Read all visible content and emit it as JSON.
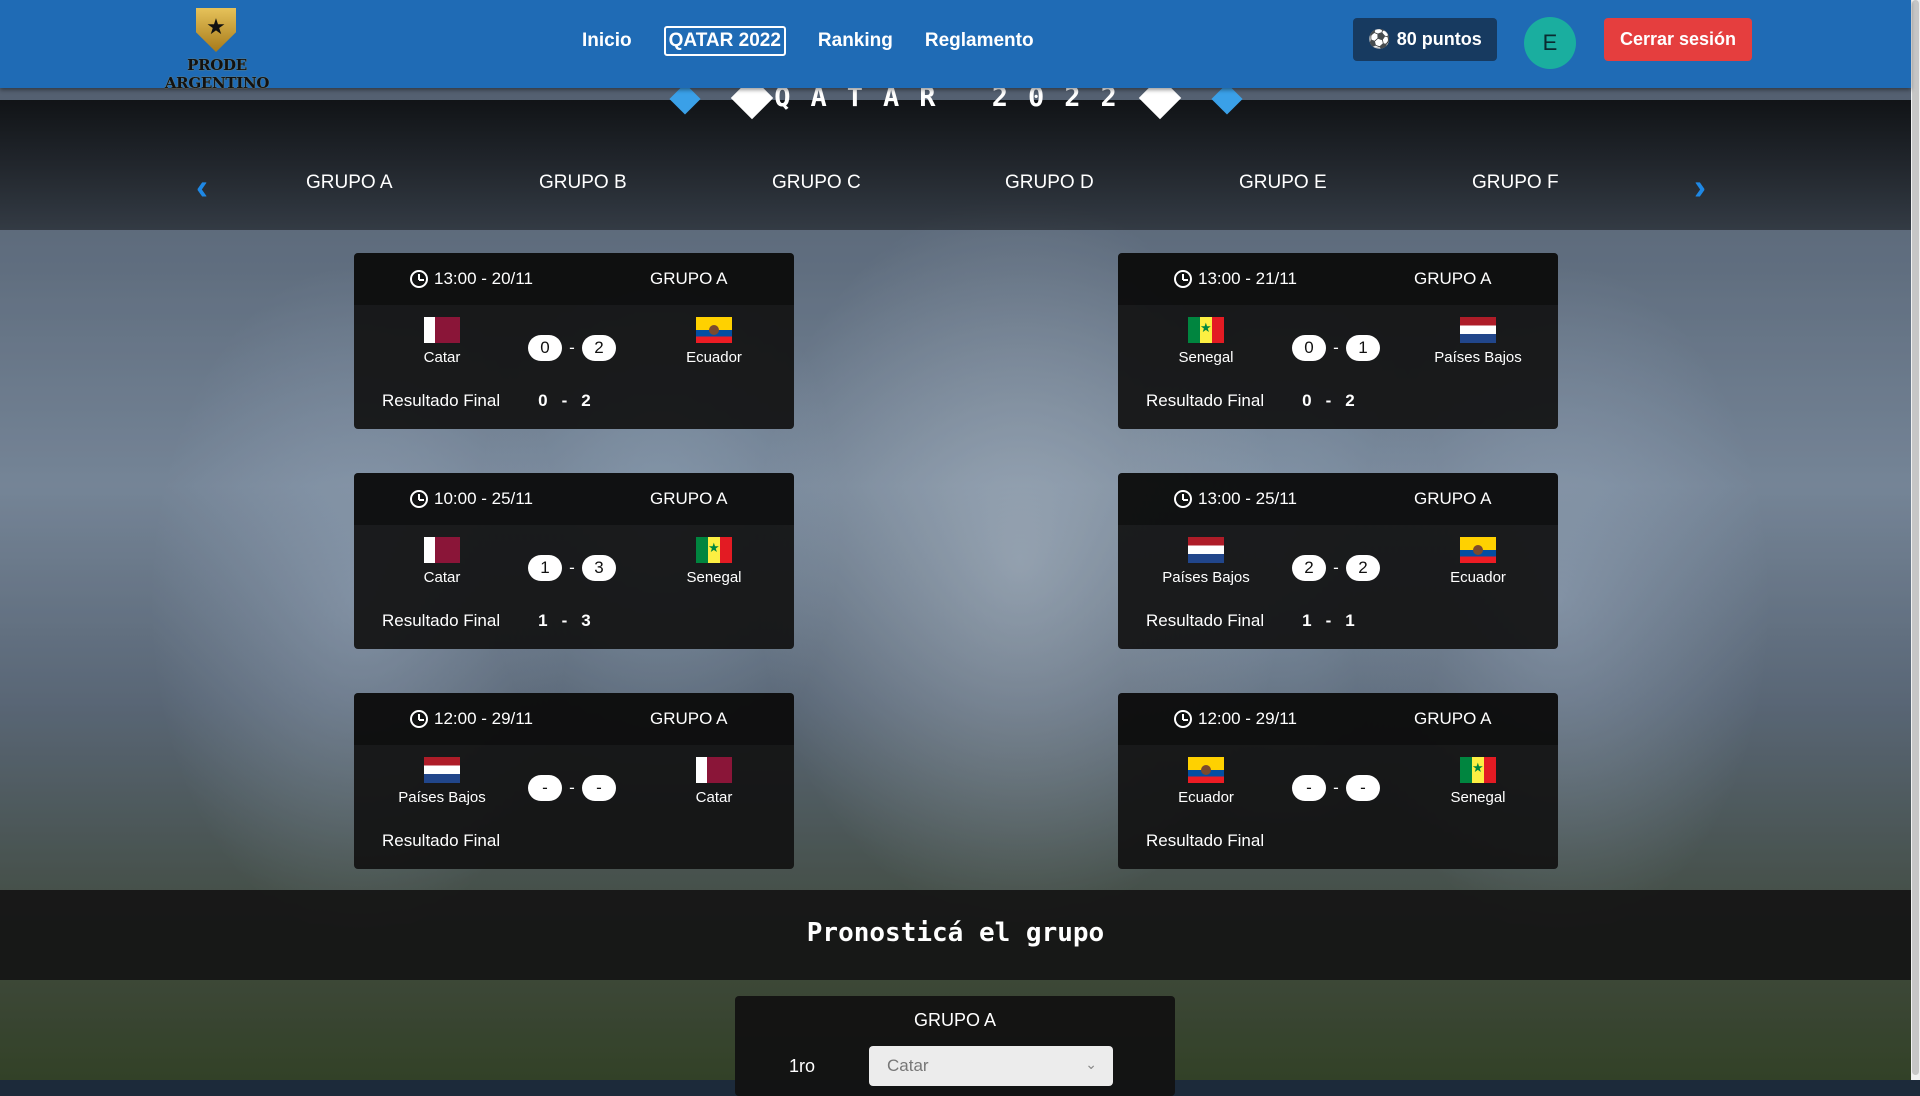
{
  "header": {
    "logo_text": "PRODE ARGENTINO",
    "nav": [
      "Inicio",
      "QATAR 2022",
      "Ranking",
      "Reglamento"
    ],
    "nav_active": "QATAR 2022",
    "points_label": "80 puntos",
    "avatar_letter": "E",
    "logout_label": "Cerrar sesión"
  },
  "title": "QATAR 2022",
  "groups": [
    "GRUPO A",
    "GRUPO B",
    "GRUPO C",
    "GRUPO D",
    "GRUPO E",
    "GRUPO F"
  ],
  "matches": [
    {
      "time": "13:00 - 20/11",
      "group": "GRUPO A",
      "home": "Catar",
      "away": "Ecuador",
      "pred_home": "0",
      "pred_away": "2",
      "result_label": "Resultado Final",
      "res_home": "0",
      "res_away": "2"
    },
    {
      "time": "13:00 - 21/11",
      "group": "GRUPO A",
      "home": "Senegal",
      "away": "Países Bajos",
      "pred_home": "0",
      "pred_away": "1",
      "result_label": "Resultado Final",
      "res_home": "0",
      "res_away": "2"
    },
    {
      "time": "10:00 - 25/11",
      "group": "GRUPO A",
      "home": "Catar",
      "away": "Senegal",
      "pred_home": "1",
      "pred_away": "3",
      "result_label": "Resultado Final",
      "res_home": "1",
      "res_away": "3"
    },
    {
      "time": "13:00 - 25/11",
      "group": "GRUPO A",
      "home": "Países Bajos",
      "away": "Ecuador",
      "pred_home": "2",
      "pred_away": "2",
      "result_label": "Resultado Final",
      "res_home": "1",
      "res_away": "1"
    },
    {
      "time": "12:00 - 29/11",
      "group": "GRUPO A",
      "home": "Países Bajos",
      "away": "Catar",
      "pred_home": "-",
      "pred_away": "-",
      "result_label": "Resultado Final",
      "res_home": "",
      "res_away": ""
    },
    {
      "time": "12:00 - 29/11",
      "group": "GRUPO A",
      "home": "Ecuador",
      "away": "Senegal",
      "pred_home": "-",
      "pred_away": "-",
      "result_label": "Resultado Final",
      "res_home": "",
      "res_away": ""
    }
  ],
  "score_separator": "-",
  "pronostica": {
    "title": "Pronosticá el grupo",
    "group": "GRUPO A",
    "position_label": "1ro",
    "selected": "Catar"
  },
  "colors": {
    "header_bg": "#1f6bb5",
    "points_bg": "#173a60",
    "avatar_bg": "#1aae9f",
    "logout_bg": "#e53e3e",
    "arrow": "#1e88e5"
  }
}
